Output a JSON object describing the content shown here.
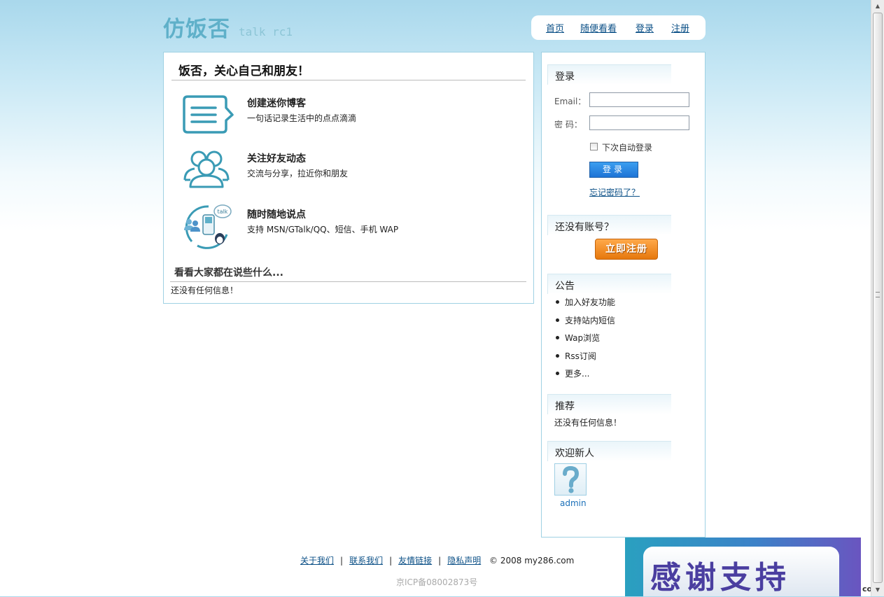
{
  "header": {
    "logo_text": "仿饭否",
    "logo_sub": "talk rc1",
    "nav": [
      {
        "label": "首页"
      },
      {
        "label": "随便看看"
      },
      {
        "label": "登录"
      },
      {
        "label": "注册"
      }
    ]
  },
  "main": {
    "title": "饭否，关心自己和朋友！",
    "features": [
      {
        "icon": "chat-bubble-icon",
        "title": "创建迷你博客",
        "desc": "一句话记录生活中的点点滴滴"
      },
      {
        "icon": "friends-icon",
        "title": "关注好友动态",
        "desc": "交流与分享，拉近你和朋友"
      },
      {
        "icon": "talk-devices-icon",
        "title": "随时随地说点",
        "desc": "支持 MSN/GTalk/QQ、短信、手机 WAP"
      }
    ],
    "look_title": "看看大家都在说些什么...",
    "look_empty": "还没有任何信息！"
  },
  "sidebar": {
    "login": {
      "title": "登录",
      "email_label": "Email：",
      "email_value": "",
      "password_label": "密 码：",
      "password_value": "",
      "remember_label": "下次自动登录",
      "remember_checked": false,
      "submit_label": "登录",
      "forgot_label": "忘记密码了？"
    },
    "register": {
      "title": "还没有账号？",
      "button_label": "立即注册"
    },
    "notice": {
      "title": "公告",
      "items": [
        "加入好友功能",
        "支持站内短信",
        "Wap浏览",
        "Rss订阅",
        "更多..."
      ]
    },
    "recommend": {
      "title": "推荐",
      "empty": "还没有任何信息！"
    },
    "newcomers": {
      "title": "欢迎新人",
      "users": [
        {
          "name": "admin",
          "avatar": "question-mark-avatar-icon"
        }
      ]
    }
  },
  "footer": {
    "links": [
      "关于我们",
      "联系我们",
      "友情链接",
      "隐私声明"
    ],
    "separator": "|",
    "copyright": "© 2008 my286.com",
    "icp": "京ICP备08002873号"
  },
  "banner": {
    "text": "感谢支持",
    "side_text": "com"
  },
  "colors": {
    "accent": "#5fb0c9",
    "link": "#0a4f86",
    "login_button": "#2a86e0",
    "register_button": "#f08a1e",
    "border": "#9fd1e3"
  }
}
